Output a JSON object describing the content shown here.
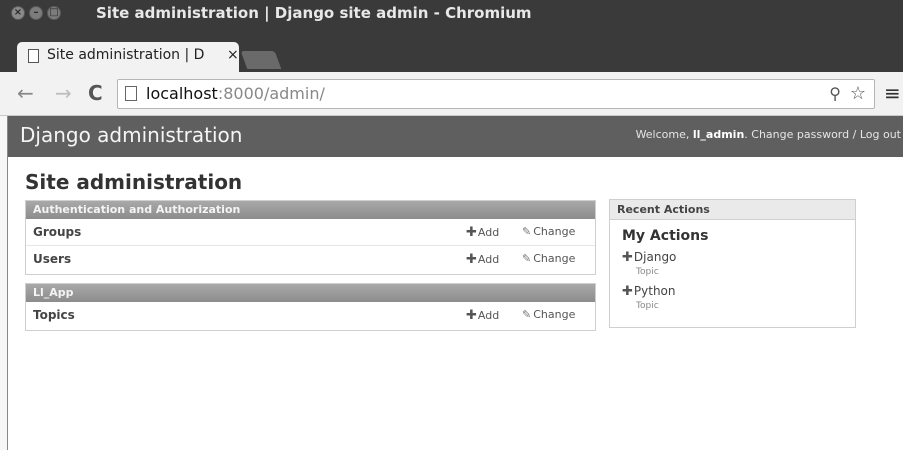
{
  "window": {
    "title": "Site administration | Django site admin - Chromium",
    "close_glyph": "×",
    "min_glyph": "–",
    "max_glyph": "□"
  },
  "tab": {
    "title": "Site administration | D",
    "close_glyph": "×"
  },
  "toolbar": {
    "back_glyph": "←",
    "forward_glyph": "→",
    "reload_glyph": "C",
    "url_host": "localhost",
    "url_path": ":8000/admin/",
    "key_glyph": "⚲",
    "star_glyph": "☆",
    "menu_glyph": "≡"
  },
  "header": {
    "branding": "Django administration",
    "welcome": "Welcome, ",
    "username": "ll_admin",
    "sep": ". ",
    "change_password": "Change password",
    "slash": " / ",
    "logout": "Log out"
  },
  "page_title": "Site administration",
  "modules": [
    {
      "caption": "Authentication and Authorization",
      "rows": [
        {
          "label": "Groups",
          "add": "Add",
          "change": "Change"
        },
        {
          "label": "Users",
          "add": "Add",
          "change": "Change"
        }
      ]
    },
    {
      "caption": "Ll_App",
      "rows": [
        {
          "label": "Topics",
          "add": "Add",
          "change": "Change"
        }
      ]
    }
  ],
  "recent": {
    "caption": "Recent Actions",
    "heading": "My Actions",
    "items": [
      {
        "name": "Django",
        "type": "Topic"
      },
      {
        "name": "Python",
        "type": "Topic"
      }
    ]
  },
  "icons": {
    "plus": "✚",
    "pencil": "✎"
  },
  "colors": {
    "header_bg": "#5f5f5f",
    "caption_bg": "#999999",
    "titlebar_bg": "#3a3a3a"
  }
}
